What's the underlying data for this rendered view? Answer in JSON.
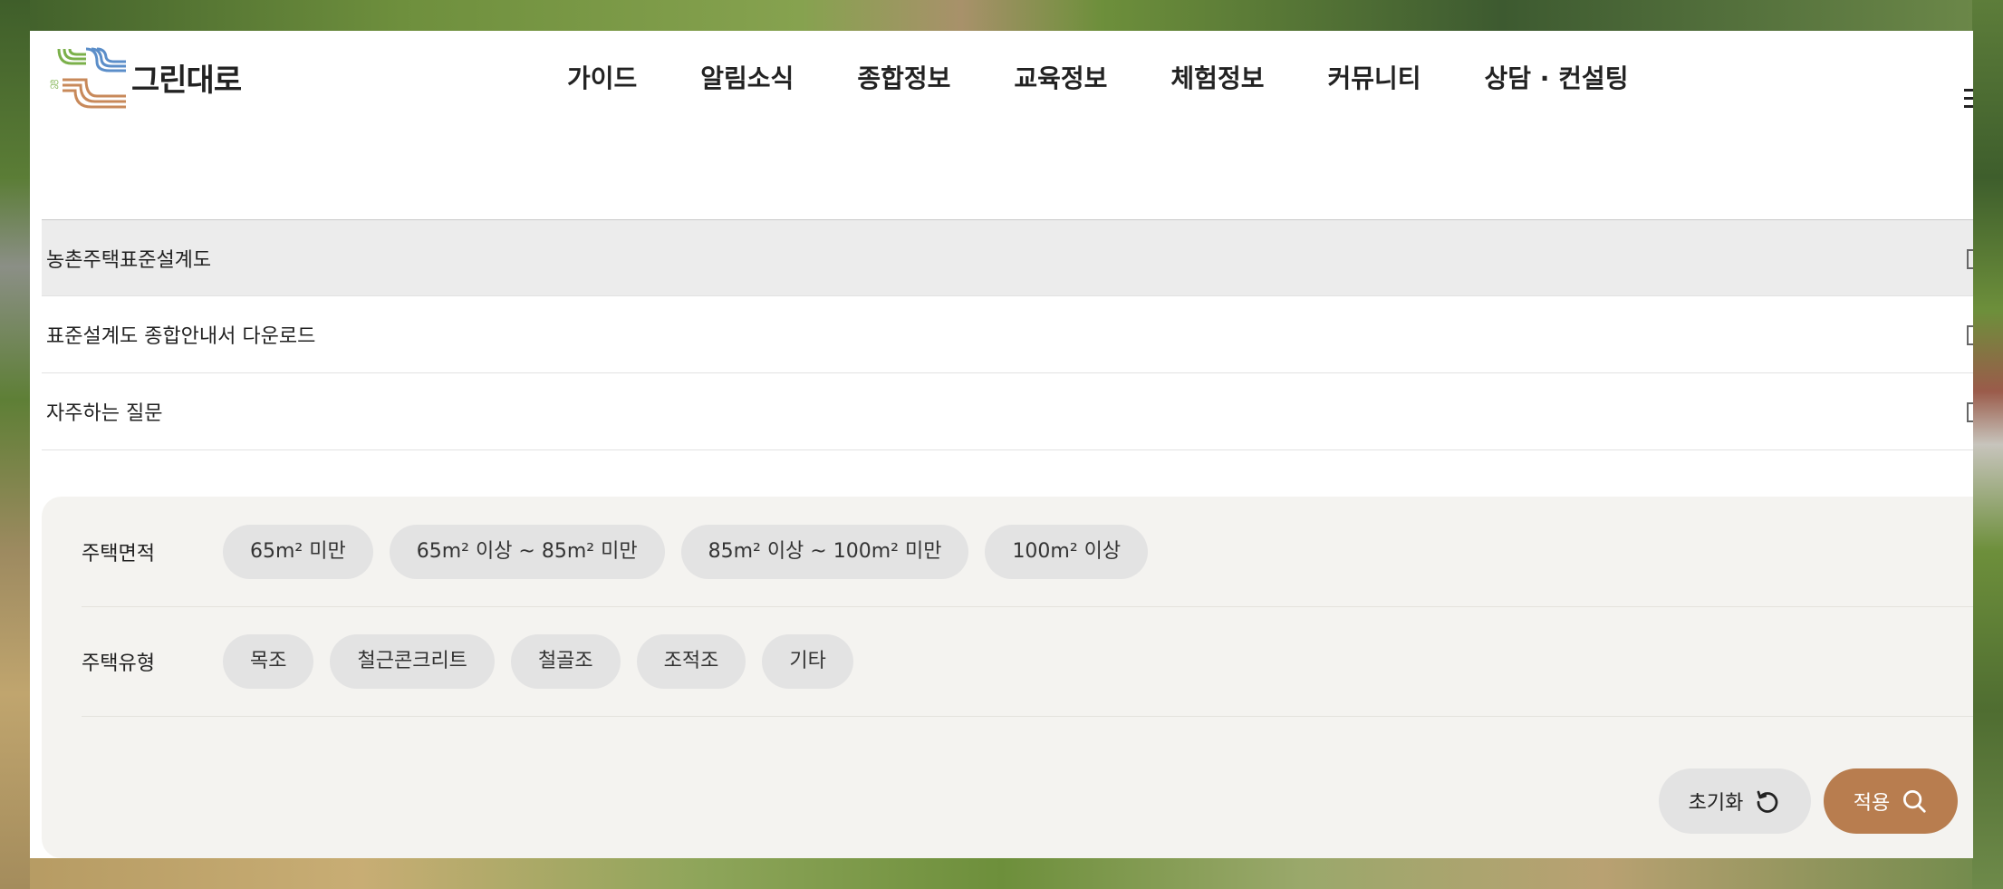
{
  "brand": {
    "name": "그린대로",
    "accent": "#b87d4f"
  },
  "nav": {
    "items": [
      "가이드",
      "알림소식",
      "종합정보",
      "교육정보",
      "체험정보",
      "커뮤니티",
      "상담 · 컨설팅"
    ]
  },
  "list": {
    "items": [
      {
        "label": "농촌주택표준설계도",
        "active": true
      },
      {
        "label": "표준설계도 종합안내서 다운로드",
        "active": false
      },
      {
        "label": "자주하는 질문",
        "active": false
      }
    ]
  },
  "filter": {
    "area": {
      "label": "주택면적",
      "options": [
        "65m² 미만",
        "65m² 이상 ~ 85m² 미만",
        "85m² 이상 ~ 100m² 미만",
        "100m² 이상"
      ]
    },
    "type": {
      "label": "주택유형",
      "options": [
        "목조",
        "철근콘크리트",
        "철골조",
        "조적조",
        "기타"
      ]
    },
    "reset_label": "초기화",
    "apply_label": "적용"
  }
}
